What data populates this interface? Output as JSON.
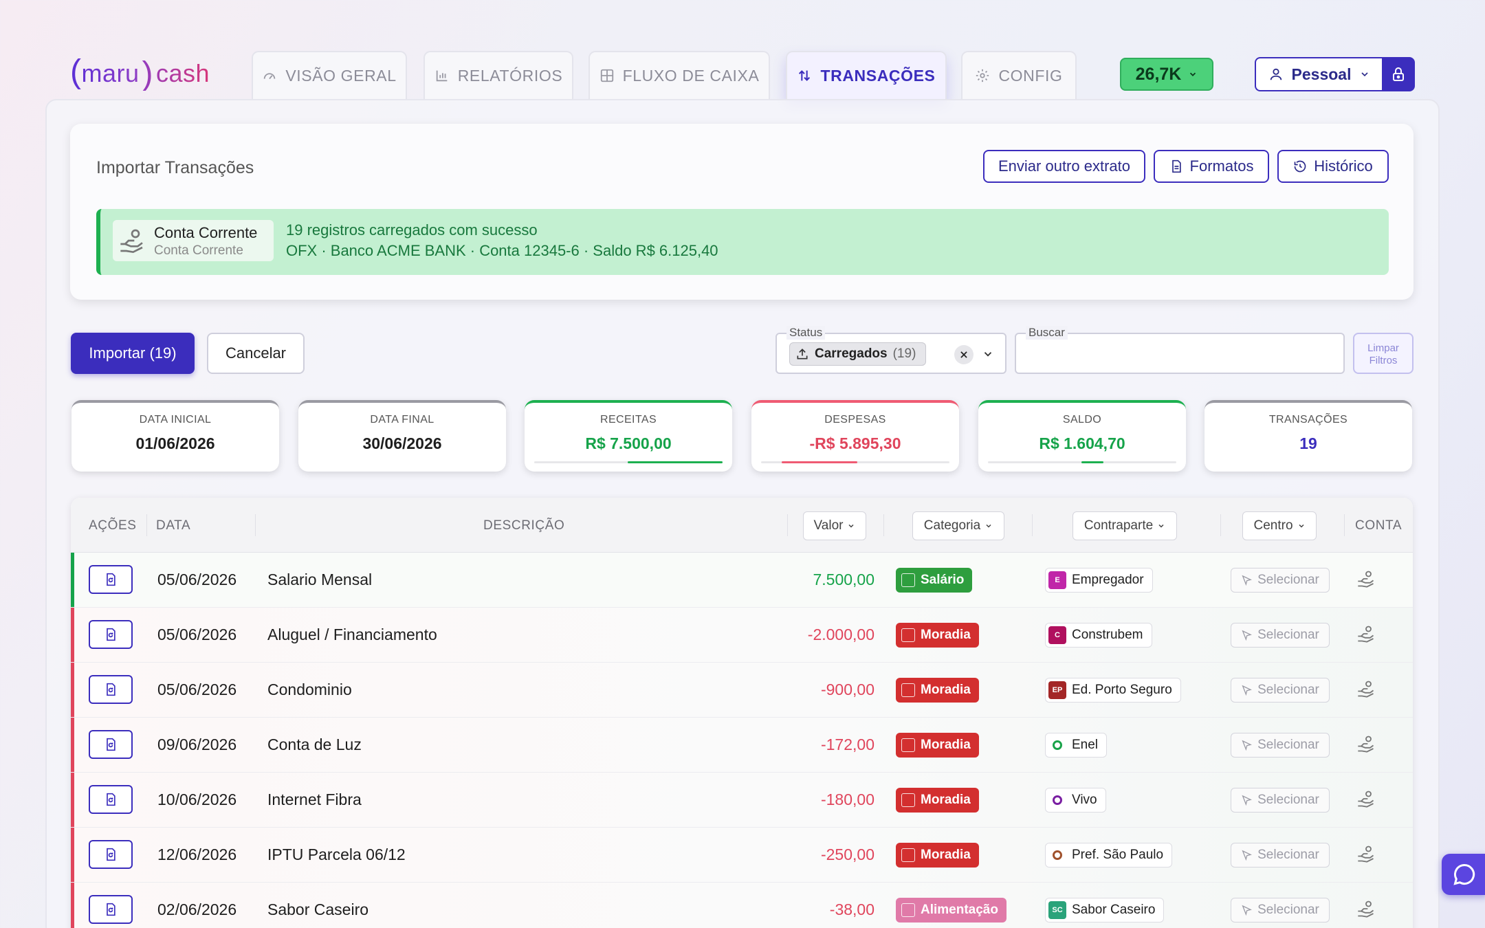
{
  "brand": {
    "left": "maru",
    "right": "cash"
  },
  "nav": {
    "tabs": [
      {
        "label": "VISÃO GERAL",
        "icon": "gauge-icon"
      },
      {
        "label": "RELATÓRIOS",
        "icon": "bar-chart-icon"
      },
      {
        "label": "FLUXO DE CAIXA",
        "icon": "grid-icon"
      },
      {
        "label": "TRANSAÇÕES",
        "icon": "arrows-up-down-icon",
        "active": true
      },
      {
        "label": "CONFIG",
        "icon": "gear-icon"
      }
    ],
    "balance": "26,7K",
    "profile": "Pessoal"
  },
  "import": {
    "title": "Importar Transações",
    "buttons": {
      "send_other": "Enviar outro extrato",
      "formats": "Formatos",
      "history": "Histórico"
    },
    "account": {
      "name": "Conta Corrente",
      "type": "Conta Corrente"
    },
    "success_line1": "19 registros carregados com sucesso",
    "success_line2": "OFX · Banco ACME BANK · Conta 12345-6 · Saldo R$ 6.125,40"
  },
  "actions": {
    "import": "Importar (19)",
    "cancel": "Cancelar"
  },
  "filters": {
    "status_label": "Status",
    "status_chip": "Carregados",
    "status_count": "(19)",
    "search_label": "Buscar",
    "search_value": "",
    "clear": "Limpar Filtros"
  },
  "stats": [
    {
      "label": "DATA INICIAL",
      "value": "01/06/2026"
    },
    {
      "label": "DATA FINAL",
      "value": "30/06/2026"
    },
    {
      "label": "RECEITAS",
      "value": "R$ 7.500,00"
    },
    {
      "label": "DESPESAS",
      "value": "-R$ 5.895,30"
    },
    {
      "label": "SALDO",
      "value": "R$ 1.604,70"
    },
    {
      "label": "TRANSAÇÕES",
      "value": "19"
    }
  ],
  "colors": {
    "primary": "#3b2dbd",
    "income": "#16a34a",
    "expense": "#e0455c",
    "salario": "#2e9e3e",
    "moradia": "#d32f2f",
    "alimentacao": "#e07aa8"
  },
  "table": {
    "headers": {
      "acoes": "AÇÕES",
      "data": "DATA",
      "descricao": "DESCRIÇÃO",
      "valor": "Valor",
      "categoria": "Categoria",
      "contraparte": "Contraparte",
      "centro": "Centro",
      "conta": "CONTA"
    },
    "select_label": "Selecionar",
    "rows": [
      {
        "date": "05/06/2026",
        "desc": "Salario Mensal",
        "value": "7.500,00",
        "type": "income",
        "category": "Salário",
        "cat_color": "#2e9e3e",
        "party": "Empregador",
        "party_tag": "E",
        "party_color": "#c026a8"
      },
      {
        "date": "05/06/2026",
        "desc": "Aluguel / Financiamento",
        "value": "-2.000,00",
        "type": "expense",
        "category": "Moradia",
        "cat_color": "#d32f2f",
        "party": "Construbem",
        "party_tag": "C",
        "party_color": "#b0105e"
      },
      {
        "date": "05/06/2026",
        "desc": "Condominio",
        "value": "-900,00",
        "type": "expense",
        "category": "Moradia",
        "cat_color": "#d32f2f",
        "party": "Ed. Porto Seguro",
        "party_tag": "EP",
        "party_color": "#a32626"
      },
      {
        "date": "09/06/2026",
        "desc": "Conta de Luz",
        "value": "-172,00",
        "type": "expense",
        "category": "Moradia",
        "cat_color": "#d32f2f",
        "party": "Enel",
        "party_tag": "",
        "party_color": "#ffffff",
        "party_icon": "enel-logo-icon"
      },
      {
        "date": "10/06/2026",
        "desc": "Internet Fibra",
        "value": "-180,00",
        "type": "expense",
        "category": "Moradia",
        "cat_color": "#d32f2f",
        "party": "Vivo",
        "party_tag": "",
        "party_color": "#ffffff",
        "party_icon": "vivo-logo-icon"
      },
      {
        "date": "12/06/2026",
        "desc": "IPTU Parcela 06/12",
        "value": "-250,00",
        "type": "expense",
        "category": "Moradia",
        "cat_color": "#d32f2f",
        "party": "Pref. São Paulo",
        "party_tag": "",
        "party_color": "#ffffff",
        "party_icon": "sp-crest-icon"
      },
      {
        "date": "02/06/2026",
        "desc": "Sabor Caseiro",
        "value": "-38,00",
        "type": "expense",
        "category": "Alimentação",
        "cat_color": "#e07aa8",
        "party": "Sabor Caseiro",
        "party_tag": "SC",
        "party_color": "#2aa37a"
      }
    ]
  }
}
